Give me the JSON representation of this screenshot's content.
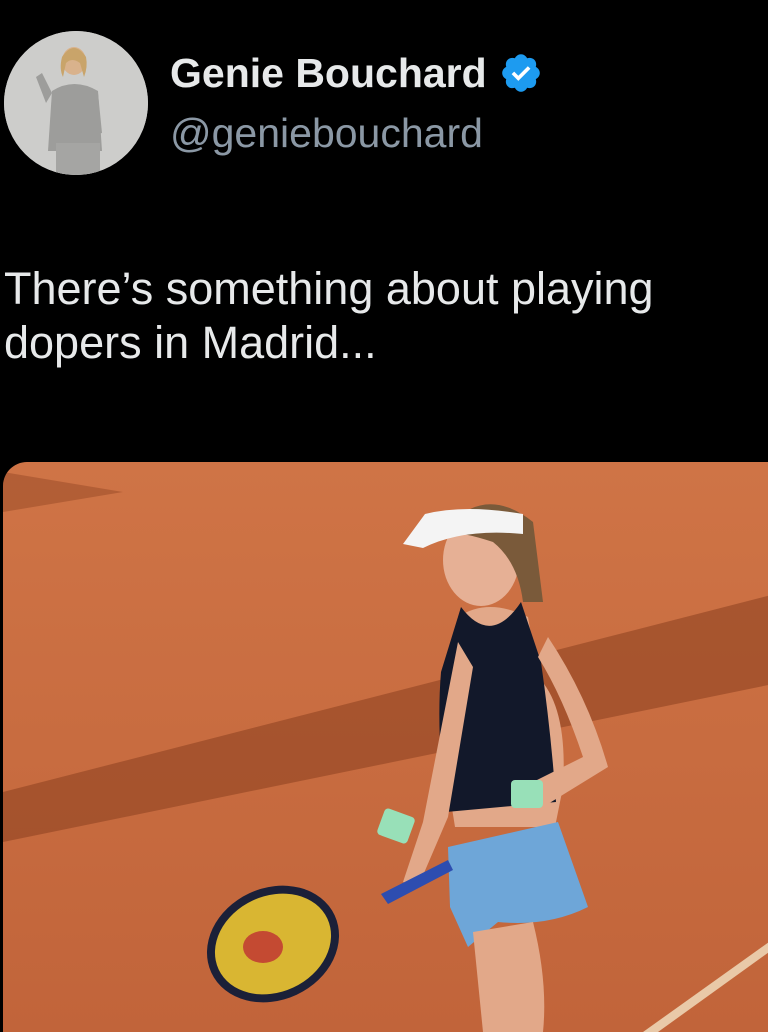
{
  "tweet": {
    "author_name": "Genie Bouchard",
    "author_handle": "@geniebouchard",
    "verified": true,
    "text": "There’s something about playing\ndopers in Madrid...",
    "avatar_icon": "profile-photo",
    "media_description_icon": "tennis-player-photo"
  },
  "colors": {
    "background": "#000000",
    "name": "#e7e9ea",
    "handle": "#8b98a5",
    "verified_badge": "#1d9bf0",
    "clay": "#c86a3e"
  }
}
